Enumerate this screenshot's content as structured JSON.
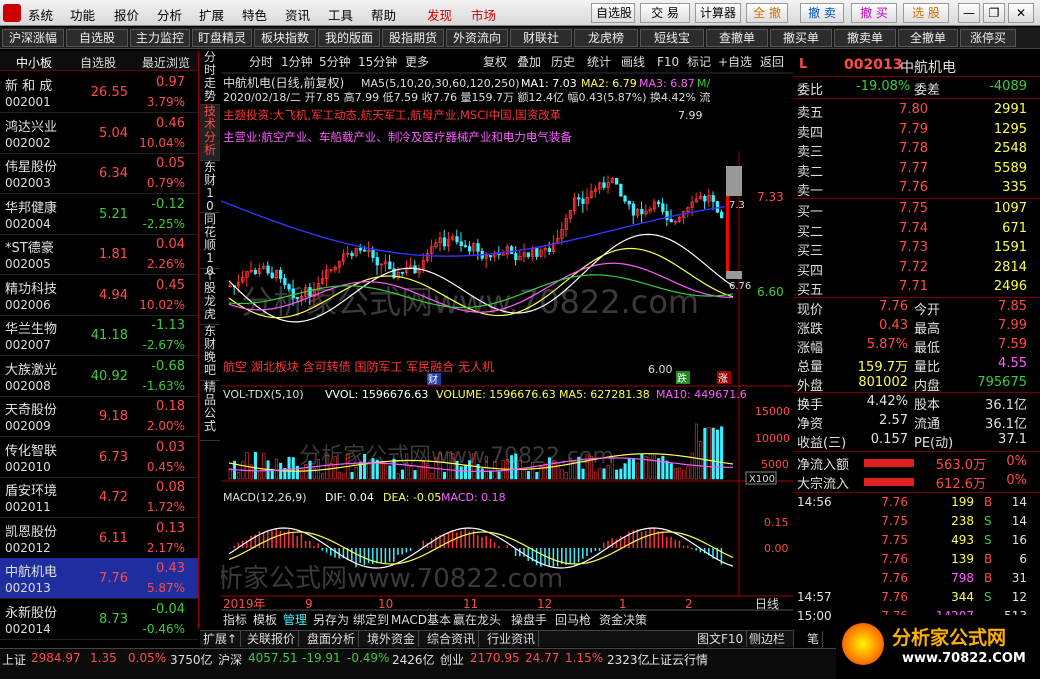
{
  "menu": {
    "items": [
      "系统",
      "功能",
      "报价",
      "分析",
      "扩展",
      "特色",
      "资讯",
      "工具",
      "帮助"
    ],
    "discover": "发现",
    "market": "市场",
    "right_buttons": [
      "自选股",
      "交 易",
      "计算器",
      "全 撤",
      "撤 卖",
      "撤 买",
      "选 股"
    ]
  },
  "toolbar": [
    "沪深涨幅",
    "自选股",
    "主力监控",
    "盯盘精灵",
    "板块指数",
    "我的版面",
    "股指期货",
    "外资流向",
    "财联社",
    "龙虎榜",
    "短线宝",
    "查撤单",
    "撤买单",
    "撤卖单",
    "全撤单",
    "涨停买"
  ],
  "list": {
    "tab_active": "中小板",
    "tab2": "自选股",
    "tab3": "最近浏览",
    "rows": [
      {
        "name": "新 和 成",
        "code": "002001",
        "price": "26.55",
        "chg": "0.97",
        "pct": "3.79%",
        "dir": "up"
      },
      {
        "name": "鸿达兴业",
        "code": "002002",
        "price": "5.04",
        "chg": "0.46",
        "pct": "10.04%",
        "dir": "up"
      },
      {
        "name": "伟星股份",
        "code": "002003",
        "price": "6.34",
        "chg": "0.05",
        "pct": "0.79%",
        "dir": "up"
      },
      {
        "name": "华邦健康",
        "code": "002004",
        "price": "5.21",
        "chg": "-0.12",
        "pct": "-2.25%",
        "dir": "down"
      },
      {
        "name": "*ST德豪",
        "code": "002005",
        "price": "1.81",
        "chg": "0.04",
        "pct": "2.26%",
        "dir": "up"
      },
      {
        "name": "精功科技",
        "code": "002006",
        "price": "4.94",
        "chg": "0.45",
        "pct": "10.02%",
        "dir": "up"
      },
      {
        "name": "华兰生物",
        "code": "002007",
        "price": "41.18",
        "chg": "-1.13",
        "pct": "-2.67%",
        "dir": "down"
      },
      {
        "name": "大族激光",
        "code": "002008",
        "price": "40.92",
        "chg": "-0.68",
        "pct": "-1.63%",
        "dir": "down"
      },
      {
        "name": "天奇股份",
        "code": "002009",
        "price": "9.18",
        "chg": "0.18",
        "pct": "2.00%",
        "dir": "up"
      },
      {
        "name": "传化智联",
        "code": "002010",
        "price": "6.73",
        "chg": "0.03",
        "pct": "0.45%",
        "dir": "up"
      },
      {
        "name": "盾安环境",
        "code": "002011",
        "price": "4.72",
        "chg": "0.08",
        "pct": "1.72%",
        "dir": "up"
      },
      {
        "name": "凯恩股份",
        "code": "002012",
        "price": "6.11",
        "chg": "0.13",
        "pct": "2.17%",
        "dir": "up"
      },
      {
        "name": "中航机电",
        "code": "002013",
        "price": "7.76",
        "chg": "0.43",
        "pct": "5.87%",
        "dir": "up",
        "selected": true
      },
      {
        "name": "永新股份",
        "code": "002014",
        "price": "8.73",
        "chg": "-0.04",
        "pct": "-0.46%",
        "dir": "down"
      }
    ]
  },
  "vtabs": [
    "分时走势",
    "技术分析",
    "东财10",
    "同花顺10",
    "个股龙虎",
    "东财晚吧",
    "精品公式"
  ],
  "chart": {
    "header": "中航机电(日线,前复权)",
    "ma_label": "MA5(5,10,20,30,60,120,250)",
    "ma1": "MA1: 7.03",
    "ma2": "MA2: 6.79",
    "ma3": "MA3: 6.87",
    "ma_more": "M/",
    "info_line": "2020/02/18/二 开7.85 高7.99 低7.59 收7.76 量159.7万 额12.4亿 幅0.43(5.87%) 换4.42% 流",
    "theme": "主题投资:大飞机,军工动态,航天军工,航母产业,MSCI中国,国资改革",
    "business": "主营业:航空产业、车船载产业、制冷及医疗器械产业和电力电气装备",
    "sector": "航空 湖北板块 含可转债 国防军工 军民融合 无人机",
    "price_hi": "7.99",
    "price_lo": "6.00",
    "axis_top": "7.33",
    "axis_bot": "6.60",
    "axis_mid": "7.3",
    "axis_mid2": "6.76",
    "buttons": [
      "分时",
      "1分钟",
      "5分钟",
      "15分钟",
      "更多"
    ],
    "buttons2": [
      "复权",
      "叠加",
      "历史",
      "统计",
      "画线",
      "F10",
      "标记",
      "+自选",
      "返回"
    ],
    "marker_cai": "财",
    "marker_die": "跌",
    "marker_zhang": "涨",
    "vol_label": "VOL-TDX(5,10)",
    "vvol": "VVOL: 1596676.63",
    "volume": "VOLUME: 1596676.63",
    "vma5": "MA5: 627281.38",
    "vma10": "MA10: 449671.6",
    "vol_ticks": [
      "15000",
      "10000",
      "5000"
    ],
    "vol_x": "X100",
    "macd_label": "MACD(12,26,9)",
    "dif": "DIF: 0.04",
    "dea": "DEA: -0.05",
    "macd": "MACD: 0.18",
    "macd_ticks": [
      "0.15",
      "0.00"
    ],
    "xlabels": [
      "2019年",
      "9",
      "10",
      "11",
      "12",
      "1",
      "2"
    ],
    "period": "日线",
    "watermark": "分析家公式网www.70822.com",
    "tabs_row": [
      "指标",
      "模板",
      "管理",
      "另存为",
      "绑定到",
      "MACD基本",
      "赢在龙头",
      "操盘手",
      "回马枪",
      "资金决策"
    ]
  },
  "quote": {
    "flag": "L",
    "code": "002013",
    "name": "中航机电",
    "wb_label": "委比",
    "wb": "-19.08%",
    "wc_label": "委差",
    "wc": "-4089",
    "sell": [
      {
        "l": "卖五",
        "p": "7.80",
        "v": "2991"
      },
      {
        "l": "卖四",
        "p": "7.79",
        "v": "1295"
      },
      {
        "l": "卖三",
        "p": "7.78",
        "v": "2548"
      },
      {
        "l": "卖二",
        "p": "7.77",
        "v": "5589"
      },
      {
        "l": "卖一",
        "p": "7.76",
        "v": "335"
      }
    ],
    "buy": [
      {
        "l": "买一",
        "p": "7.75",
        "v": "1097"
      },
      {
        "l": "买二",
        "p": "7.74",
        "v": "671"
      },
      {
        "l": "买三",
        "p": "7.73",
        "v": "1591"
      },
      {
        "l": "买四",
        "p": "7.72",
        "v": "2814"
      },
      {
        "l": "买五",
        "p": "7.71",
        "v": "2496"
      }
    ],
    "stats": [
      [
        "现价",
        "7.76",
        "今开",
        "7.85"
      ],
      [
        "涨跌",
        "0.43",
        "最高",
        "7.99"
      ],
      [
        "涨幅",
        "5.87%",
        "最低",
        "7.59"
      ],
      [
        "总量",
        "159.7万",
        "量比",
        "4.55"
      ],
      [
        "外盘",
        "801002",
        "内盘",
        "795675"
      ]
    ],
    "stats2": [
      [
        "换手",
        "4.42%",
        "股本",
        "36.1亿"
      ],
      [
        "净资",
        "2.57",
        "流通",
        "36.1亿"
      ],
      [
        "收益(三)",
        "0.157",
        "PE(动)",
        "37.1"
      ]
    ],
    "flows": [
      [
        "净流入额",
        "563.0万",
        "0%"
      ],
      [
        "大宗流入",
        "612.6万",
        "0%"
      ]
    ],
    "ticks": [
      [
        "14:56",
        "7.76",
        "199",
        "B",
        "14"
      ],
      [
        "",
        "7.75",
        "238",
        "S",
        "14"
      ],
      [
        "",
        "7.75",
        "493",
        "S",
        "16"
      ],
      [
        "",
        "7.76",
        "139",
        "B",
        "6"
      ],
      [
        "",
        "7.76",
        "798",
        "B",
        "31"
      ],
      [
        "14:57",
        "7.76",
        "344",
        "S",
        "12"
      ],
      [
        "15:00",
        "7.76",
        "14207",
        "",
        "513"
      ]
    ]
  },
  "bottomtabs": [
    "扩展↑",
    "关联报价",
    "盘面分析",
    "境外资金",
    "综合资讯",
    "行业资讯"
  ],
  "bottom_right": [
    "图文F10",
    "侧边栏《",
    "笔"
  ],
  "status": {
    "sh_label": "上证",
    "sh": "2984.97",
    "sh_chg": "1.35",
    "sh_pct": "0.05%",
    "sh_amt": "3750亿",
    "hs_label": "沪深",
    "hs": "4057.51",
    "hs_chg": "-19.91",
    "hs_pct": "-0.49%",
    "hs_amt": "2426亿",
    "cy_label": "创业",
    "cy": "2170.95",
    "cy_chg": "24.77",
    "cy_pct": "1.15%",
    "cy_amt": "2323亿",
    "cloud": "上证云行情",
    "logo": "分析家公式网",
    "logo_url": "www.70822.COM"
  }
}
